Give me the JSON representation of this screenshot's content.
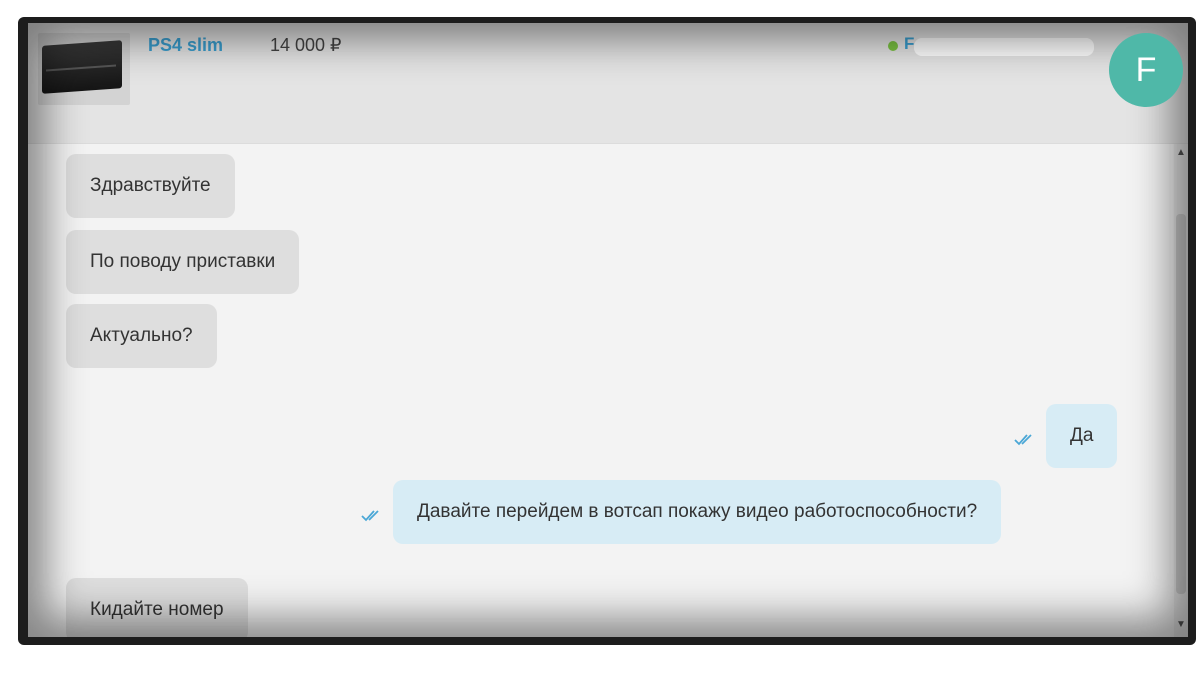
{
  "listing": {
    "title": "PS4 slim",
    "price": "14 000 ₽"
  },
  "seller": {
    "name_visible": "Fo",
    "online": true,
    "avatar_letter": "F"
  },
  "colors": {
    "accent": "#3a9fd0",
    "online": "#7cc443",
    "avatar": "#4fb8a8",
    "incoming_bubble": "#dedede",
    "outgoing_bubble": "#d7ecf5"
  },
  "messages": [
    {
      "direction": "in",
      "text": "Здравствуйте"
    },
    {
      "direction": "in",
      "text": "По поводу приставки"
    },
    {
      "direction": "in",
      "text": "Актуально?"
    },
    {
      "direction": "out",
      "text": "Да",
      "status": "read"
    },
    {
      "direction": "out",
      "text": "Давайте перейдем в вотсап покажу видео работоспособности?",
      "status": "read"
    },
    {
      "direction": "in",
      "text": "Кидайте номер"
    }
  ]
}
